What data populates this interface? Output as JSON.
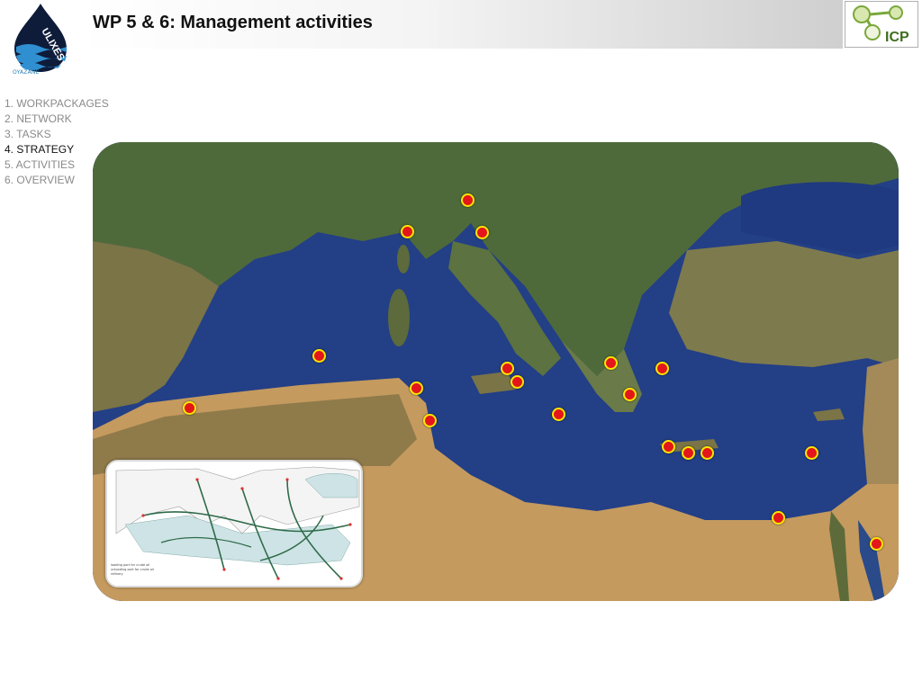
{
  "slide": {
    "title": "WP 5 & 6: Management activities"
  },
  "logos": {
    "left": {
      "text": "ULIXES",
      "caption": "OYAZANE"
    },
    "right": {
      "text": "ICP"
    }
  },
  "nav": {
    "items": [
      {
        "label": "1. WORKPACKAGES",
        "active": false
      },
      {
        "label": "2. NETWORK",
        "active": false
      },
      {
        "label": "3. TASKS",
        "active": false
      },
      {
        "label": "4. STRATEGY",
        "active": true
      },
      {
        "label": "5. ACTIVITIES",
        "active": false
      },
      {
        "label": "6. OVERVIEW",
        "active": false
      }
    ]
  },
  "map": {
    "marker_colors": {
      "fill": "#e3161b",
      "ring": "#ffe600"
    },
    "sea_color": "#1f3f86",
    "marker_count": 23,
    "inset": {
      "legend": [
        "loading port for crude oil",
        "unloading port for crude oil",
        "refinery"
      ]
    }
  }
}
